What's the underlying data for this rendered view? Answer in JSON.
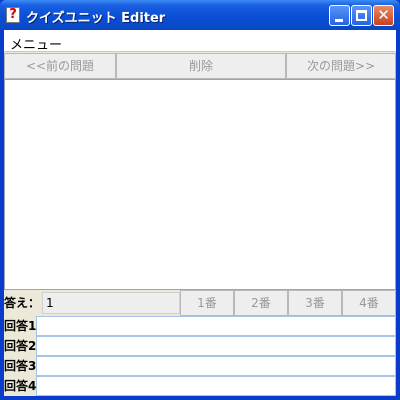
{
  "window": {
    "title": "クイズユニット Editer",
    "icon": "question-mark-icon"
  },
  "menu": {
    "label": "メニュー"
  },
  "nav": {
    "prev_label": "<<前の問題",
    "delete_label": "削除",
    "next_label": "次の問題>>"
  },
  "question": {
    "text": ""
  },
  "answer": {
    "label": "答え：",
    "value": "1",
    "buttons": [
      "1番",
      "2番",
      "3番",
      "4番"
    ]
  },
  "choices": [
    {
      "label": "回答1",
      "value": ""
    },
    {
      "label": "回答2",
      "value": ""
    },
    {
      "label": "回答3",
      "value": ""
    },
    {
      "label": "回答4",
      "value": ""
    }
  ],
  "colors": {
    "titlebar": "#0a4fd6",
    "disabled_text": "#999999",
    "close_button": "#c8401e"
  }
}
